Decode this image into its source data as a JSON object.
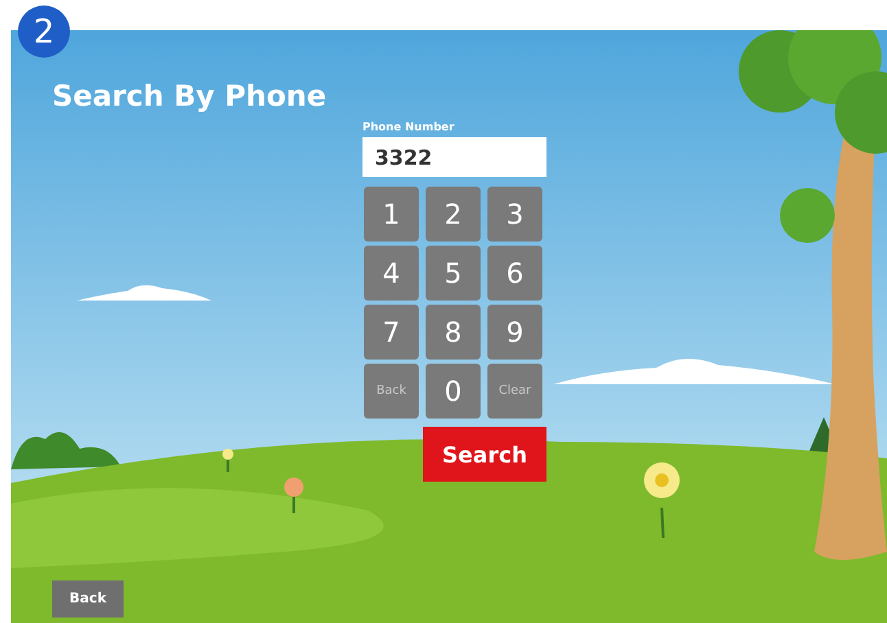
{
  "step_badge": "2",
  "title": "Search By Phone",
  "phone_field": {
    "label": "Phone Number",
    "value": "3322"
  },
  "keypad": [
    {
      "label": "1",
      "kind": "digit"
    },
    {
      "label": "2",
      "kind": "digit"
    },
    {
      "label": "3",
      "kind": "digit"
    },
    {
      "label": "4",
      "kind": "digit"
    },
    {
      "label": "5",
      "kind": "digit"
    },
    {
      "label": "6",
      "kind": "digit"
    },
    {
      "label": "7",
      "kind": "digit"
    },
    {
      "label": "8",
      "kind": "digit"
    },
    {
      "label": "9",
      "kind": "digit"
    },
    {
      "label": "Back",
      "kind": "action"
    },
    {
      "label": "0",
      "kind": "digit"
    },
    {
      "label": "Clear",
      "kind": "action"
    }
  ],
  "search_button": "Search",
  "back_button": "Back"
}
